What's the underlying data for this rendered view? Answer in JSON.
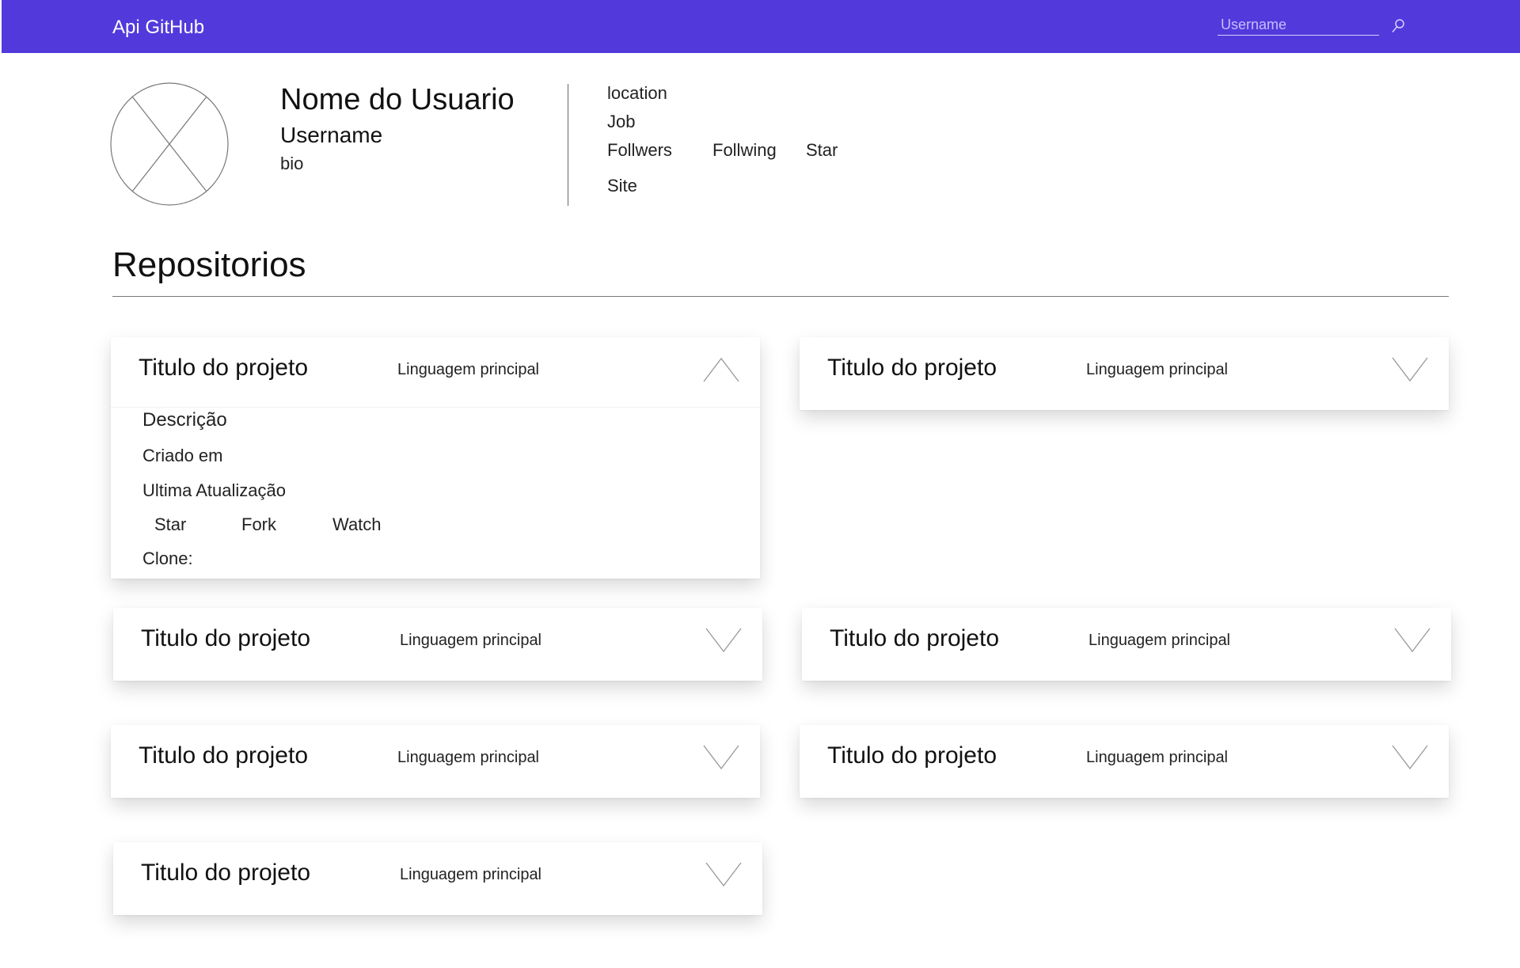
{
  "header": {
    "brand": "Api GitHub",
    "search_placeholder": "Username"
  },
  "profile": {
    "name": "Nome do Usuario",
    "username": "Username",
    "bio": "bio",
    "location": "location",
    "job": "Job",
    "followers": "Follwers",
    "following": "Follwing",
    "star": "Star",
    "site": "Site"
  },
  "section_title": "Repositorios",
  "repos": [
    {
      "title": "Titulo do projeto",
      "language": "Linguagem principal",
      "expanded": true,
      "description": "Descrição",
      "created": "Criado em",
      "updated": "Ultima Atualização",
      "star": "Star",
      "fork": "Fork",
      "watch": "Watch",
      "clone": "Clone:"
    },
    {
      "title": "Titulo do projeto",
      "language": "Linguagem principal",
      "expanded": false
    },
    {
      "title": "Titulo do projeto",
      "language": "Linguagem principal",
      "expanded": false
    },
    {
      "title": "Titulo do projeto",
      "language": "Linguagem principal",
      "expanded": false
    },
    {
      "title": "Titulo do projeto",
      "language": "Linguagem principal",
      "expanded": false
    },
    {
      "title": "Titulo do projeto",
      "language": "Linguagem principal",
      "expanded": false
    },
    {
      "title": "Titulo do projeto",
      "language": "Linguagem principal",
      "expanded": false
    }
  ],
  "colors": {
    "header_bg": "#5239dc",
    "header_text": "#ffffff"
  }
}
